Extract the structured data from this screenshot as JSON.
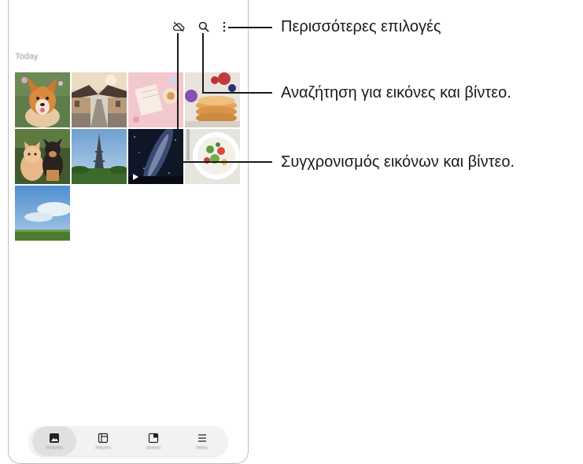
{
  "gallery": {
    "section_label": "Today",
    "toolbar": {
      "sync_icon": "cloud-off-icon",
      "search_icon": "search-icon",
      "more_icon": "more-vertical-icon"
    },
    "thumbnails": [
      {
        "subject": "corgi dog"
      },
      {
        "subject": "traditional houses street"
      },
      {
        "subject": "notebook and pastry"
      },
      {
        "subject": "pancakes and berries"
      },
      {
        "subject": "kitten and puppy"
      },
      {
        "subject": "eiffel tower"
      },
      {
        "subject": "night sky video"
      },
      {
        "subject": "salad plate"
      },
      {
        "subject": "blue sky and meadow"
      }
    ],
    "nav": [
      {
        "icon": "pictures-icon",
        "label": "Pictures"
      },
      {
        "icon": "albums-icon",
        "label": "Albums"
      },
      {
        "icon": "stories-icon",
        "label": "Stories"
      },
      {
        "icon": "menu-icon",
        "label": "Menu"
      }
    ]
  },
  "callouts": {
    "more_options": "Περισσότερες επιλογές",
    "search": "Αναζήτηση για εικόνες και βίντεο.",
    "sync": "Συγχρονισμός εικόνων και βίντεο."
  }
}
